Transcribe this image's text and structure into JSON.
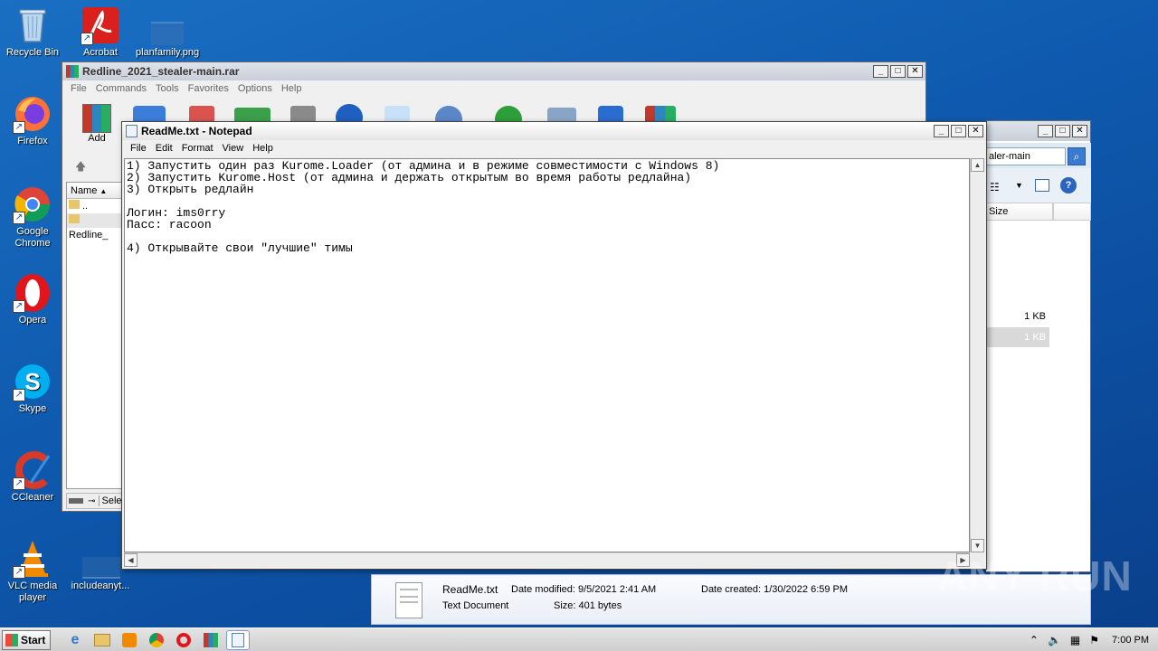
{
  "desktop": {
    "icons": [
      {
        "label": "Recycle Bin"
      },
      {
        "label": "Firefox"
      },
      {
        "label": "Google Chrome"
      },
      {
        "label": "Opera"
      },
      {
        "label": "Skype"
      },
      {
        "label": "CCleaner"
      },
      {
        "label": "VLC media player"
      },
      {
        "label": "Acrobat"
      },
      {
        "label": "planfamily.png"
      },
      {
        "label": "includeanyt..."
      }
    ]
  },
  "winrar": {
    "title": "Redline_2021_stealer-main.rar",
    "menu": [
      "File",
      "Commands",
      "Tools",
      "Favorites",
      "Options",
      "Help"
    ],
    "toolbar_add_label": "Add",
    "column_name": "Name",
    "rows": [
      "..",
      "Redline_"
    ],
    "status_partial": "Sele"
  },
  "explorer": {
    "search_text": "aler-main",
    "column_size": "Size",
    "sizes": [
      "1 KB",
      "1 KB"
    ],
    "details": {
      "filename": "ReadMe.txt",
      "type": "Text Document",
      "date_modified_label": "Date modified: 9/5/2021 2:41 AM",
      "size_label": "Size: 401 bytes",
      "date_created_label": "Date created: 1/30/2022 6:59 PM"
    }
  },
  "notepad": {
    "title": "ReadMe.txt - Notepad",
    "menu": [
      "File",
      "Edit",
      "Format",
      "View",
      "Help"
    ],
    "lines": [
      "1) Запустить один раз Kurome.Loader (от админа и в режиме совместимости с Windows 8)",
      "2) Запустить Kurome.Host (от админа и держать открытым во время работы редлайна)",
      "3) Открыть редлайн",
      "",
      "Логин: ims0rry",
      "Пасс: racoon",
      "",
      "4) Открывайте свои \"лучшие\" тимы"
    ]
  },
  "taskbar": {
    "start_label": "Start",
    "clock": "7:00 PM"
  },
  "watermark": "ANY RUN",
  "colors": {
    "desktop_blue": "#1a6fc2",
    "title_active": "#ffffff",
    "selection": "#cce8ff"
  }
}
